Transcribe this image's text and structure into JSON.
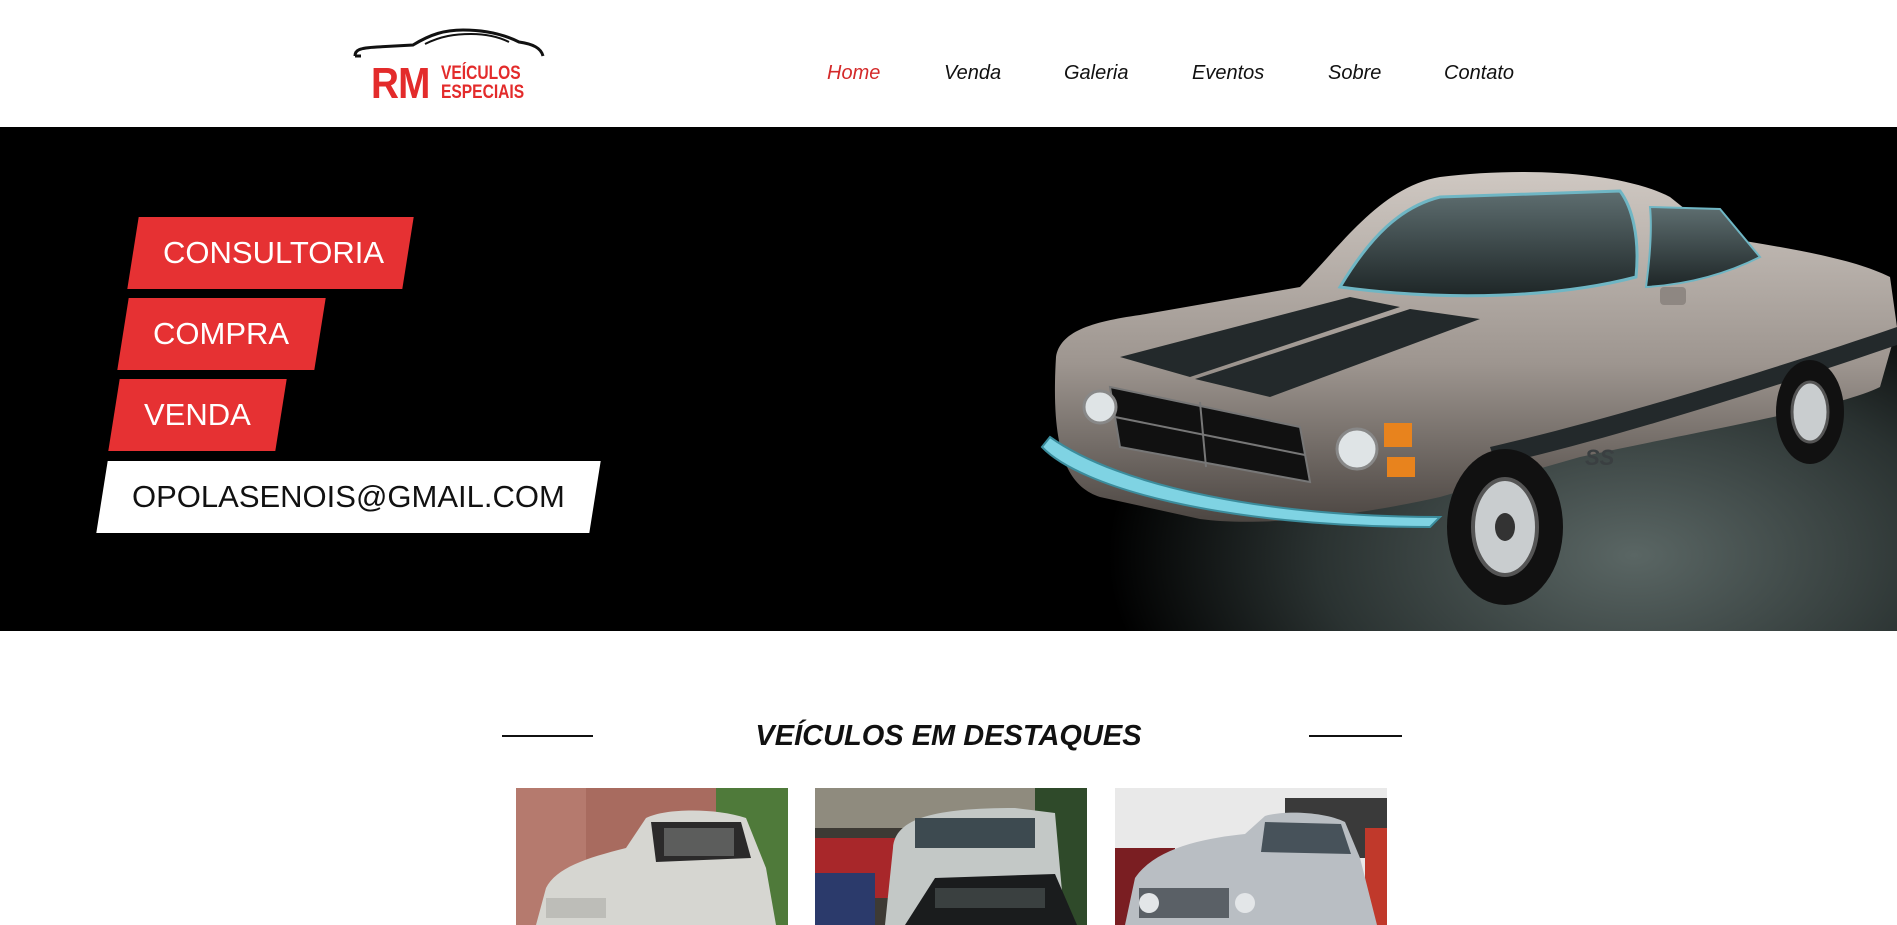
{
  "logo": {
    "primary": "RM",
    "secondary_line1": "VEÍCULOS",
    "secondary_line2": "ESPECIAIS",
    "icon": "car-outline-icon"
  },
  "nav": {
    "items": [
      {
        "label": "Home",
        "active": true
      },
      {
        "label": "Venda",
        "active": false
      },
      {
        "label": "Galeria",
        "active": false
      },
      {
        "label": "Eventos",
        "active": false
      },
      {
        "label": "Sobre",
        "active": false
      },
      {
        "label": "Contato",
        "active": false
      }
    ]
  },
  "hero": {
    "tags": [
      "CONSULTORIA",
      "COMPRA",
      "VENDA"
    ],
    "email": "OPOLASENOIS@GMAIL.COM",
    "badge": "SS"
  },
  "featured": {
    "title": "VEÍCULOS EM DESTAQUES"
  },
  "colors": {
    "accent": "#e63133",
    "nav_active": "#d42a2a",
    "hero_bg": "#000000"
  }
}
